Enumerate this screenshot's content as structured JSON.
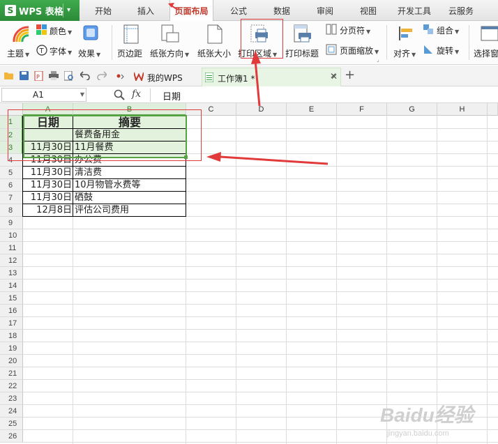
{
  "app": {
    "name": "WPS 表格",
    "menu_caret": "▾"
  },
  "menu_tabs": [
    "开始",
    "插入",
    "页面布局",
    "公式",
    "数据",
    "审阅",
    "视图",
    "开发工具",
    "云服务"
  ],
  "active_tab": "页面布局",
  "ribbon": {
    "theme": "主题",
    "colors": "颜色",
    "fonts": "字体",
    "effects": "效果",
    "margins": "页边距",
    "orientation": "纸张方向",
    "paper_size": "纸张大小",
    "print_area": "打印区域",
    "print_titles": "打印标题",
    "page_break": "分页符",
    "page_scale": "页面缩放",
    "align": "对齐",
    "group": "组合",
    "rotate": "旋转",
    "select_pane": "选择窗"
  },
  "doc_tabs": {
    "home": "我的WPS",
    "workbook": "工作簿1 *"
  },
  "formula_bar": {
    "cell_ref": "A1",
    "fx": "fx",
    "value": "日期"
  },
  "columns": [
    "A",
    "B",
    "C",
    "D",
    "E",
    "F",
    "G",
    "H"
  ],
  "rows": [
    "1",
    "2",
    "3",
    "4",
    "5",
    "6",
    "7",
    "8",
    "9",
    "10",
    "11",
    "12",
    "13",
    "14",
    "15",
    "16",
    "17",
    "18",
    "19",
    "20",
    "21",
    "22",
    "23",
    "24",
    "25",
    "26"
  ],
  "table": {
    "headers": [
      "日期",
      "摘要"
    ],
    "rows": [
      [
        "",
        "餐费备用金"
      ],
      [
        "11月30日",
        "11月餐费"
      ],
      [
        "11月30日",
        "办公费"
      ],
      [
        "11月30日",
        "清洁费"
      ],
      [
        "11月30日",
        "10月物管水费等"
      ],
      [
        "11月30日",
        "硒鼓"
      ],
      [
        "12月8日",
        "评估公司费用"
      ]
    ]
  },
  "watermark": {
    "brand": "Baidu经验",
    "url": "jingyan.baidu.com"
  },
  "colors": {
    "wps_green": "#2e9a3a",
    "selection_fill": "#e3f2dc",
    "selection_border": "#56a244",
    "annotation_red": "#e03a3a"
  }
}
